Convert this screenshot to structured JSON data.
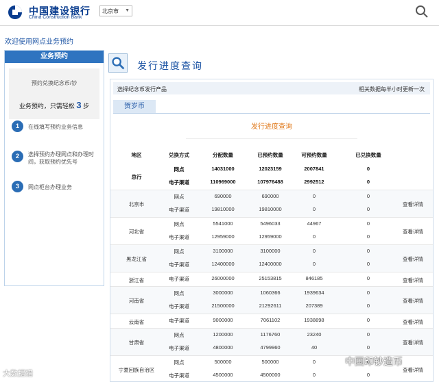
{
  "header": {
    "brand_cn": "中国建设银行",
    "brand_en": "China Construction Bank",
    "city_select": "北京市"
  },
  "welcome": "欢迎使用网点业务预约",
  "sidebar": {
    "title": "业务预约",
    "subtitle": "预约兑换纪念币/钞",
    "steps_prefix": "业务预约，只需轻松",
    "steps_count": "3",
    "steps_suffix": "步",
    "steps": [
      {
        "num": "1",
        "text": "在线填写预约业务信息"
      },
      {
        "num": "2",
        "text": "选择预约办理网点和办理时间，获取预约优先号"
      },
      {
        "num": "3",
        "text": "网点柜台办理业务"
      }
    ]
  },
  "content": {
    "title": "发行进度查询",
    "bar_left": "选择纪念币发行产品",
    "bar_right": "相关数据每半小时更新一次",
    "coin_tab": "贺岁币",
    "progress_title": "发行进度查询",
    "columns": [
      "地区",
      "兑换方式",
      "分配数量",
      "已预约数量",
      "可预约数量",
      "已兑换数量"
    ],
    "detail_label": "查看详情",
    "regions": [
      {
        "name": "总行",
        "bold": true,
        "rows": [
          {
            "channel": "网点",
            "alloc": "14031000",
            "resv": "12023159",
            "avail": "2007841",
            "ex": "0"
          },
          {
            "channel": "电子渠道",
            "alloc": "110969000",
            "resv": "107976488",
            "avail": "2992512",
            "ex": "0"
          }
        ]
      },
      {
        "name": "北京市",
        "rows": [
          {
            "channel": "网点",
            "alloc": "690000",
            "resv": "690000",
            "avail": "0",
            "ex": "0"
          },
          {
            "channel": "电子渠道",
            "alloc": "19810000",
            "resv": "19810000",
            "avail": "0",
            "ex": "0"
          }
        ]
      },
      {
        "name": "河北省",
        "rows": [
          {
            "channel": "网点",
            "alloc": "5541000",
            "resv": "5496033",
            "avail": "44967",
            "ex": "0"
          },
          {
            "channel": "电子渠道",
            "alloc": "12959000",
            "resv": "12959000",
            "avail": "0",
            "ex": "0"
          }
        ]
      },
      {
        "name": "黑龙江省",
        "rows": [
          {
            "channel": "网点",
            "alloc": "3100000",
            "resv": "3100000",
            "avail": "0",
            "ex": "0"
          },
          {
            "channel": "电子渠道",
            "alloc": "12400000",
            "resv": "12400000",
            "avail": "0",
            "ex": "0"
          }
        ]
      },
      {
        "name": "浙江省",
        "rows": [
          {
            "channel": "电子渠道",
            "alloc": "26000000",
            "resv": "25153815",
            "avail": "846185",
            "ex": "0"
          }
        ]
      },
      {
        "name": "河南省",
        "rows": [
          {
            "channel": "网点",
            "alloc": "3000000",
            "resv": "1060366",
            "avail": "1939634",
            "ex": "0"
          },
          {
            "channel": "电子渠道",
            "alloc": "21500000",
            "resv": "21292611",
            "avail": "207389",
            "ex": "0"
          }
        ]
      },
      {
        "name": "云南省",
        "rows": [
          {
            "channel": "电子渠道",
            "alloc": "9000000",
            "resv": "7061102",
            "avail": "1938898",
            "ex": "0"
          }
        ]
      },
      {
        "name": "甘肃省",
        "rows": [
          {
            "channel": "网点",
            "alloc": "1200000",
            "resv": "1176760",
            "avail": "23240",
            "ex": "0"
          },
          {
            "channel": "电子渠道",
            "alloc": "4800000",
            "resv": "4799960",
            "avail": "40",
            "ex": "0"
          }
        ]
      },
      {
        "name": "宁夏回族自治区",
        "rows": [
          {
            "channel": "网点",
            "alloc": "500000",
            "resv": "500000",
            "avail": "0",
            "ex": "0"
          },
          {
            "channel": "电子渠道",
            "alloc": "4500000",
            "resv": "4500000",
            "avail": "0",
            "ex": "0"
          }
        ]
      }
    ]
  },
  "watermarks": {
    "left": "大数据猎",
    "right": "中国印钞造币"
  },
  "colors": {
    "brand_blue": "#0a3d8f",
    "sidebar_title_bg": "#2f74c0",
    "orange_title": "#e07a1c",
    "link_blue": "#1e55a5"
  }
}
